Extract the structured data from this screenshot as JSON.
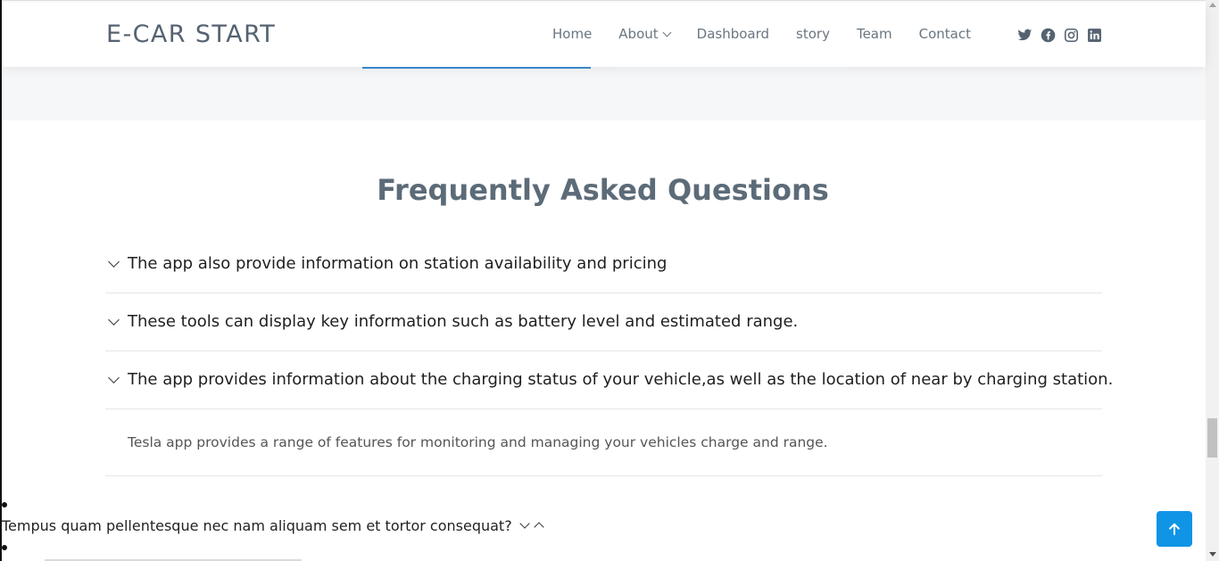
{
  "header": {
    "logo": "E-CAR START",
    "nav": [
      {
        "label": "Home",
        "has_dropdown": false
      },
      {
        "label": "About",
        "has_dropdown": true
      },
      {
        "label": "Dashboard",
        "has_dropdown": false
      },
      {
        "label": "story",
        "has_dropdown": false
      },
      {
        "label": "Team",
        "has_dropdown": false
      },
      {
        "label": "Contact",
        "has_dropdown": false
      }
    ],
    "socials": [
      "twitter-icon",
      "facebook-icon",
      "instagram-icon",
      "linkedin-icon"
    ]
  },
  "faq": {
    "title": "Frequently Asked Questions",
    "items": [
      {
        "question": "The app also provide information on station availability and pricing"
      },
      {
        "question": "These tools can display key information such as battery level and estimated range."
      },
      {
        "question": "The app provides information about the charging status of your vehicle,as well as the location of near by charging station."
      }
    ],
    "answer": "Tesla app provides a range of features for monitoring and managing your vehicles charge and range."
  },
  "stray": {
    "text": "Tempus quam pellentesque nec nam aliquam sem et tortor consequat?"
  },
  "colors": {
    "accent": "#1094e6",
    "logo": "#556270",
    "active_tab_line": "#3a86c8"
  }
}
